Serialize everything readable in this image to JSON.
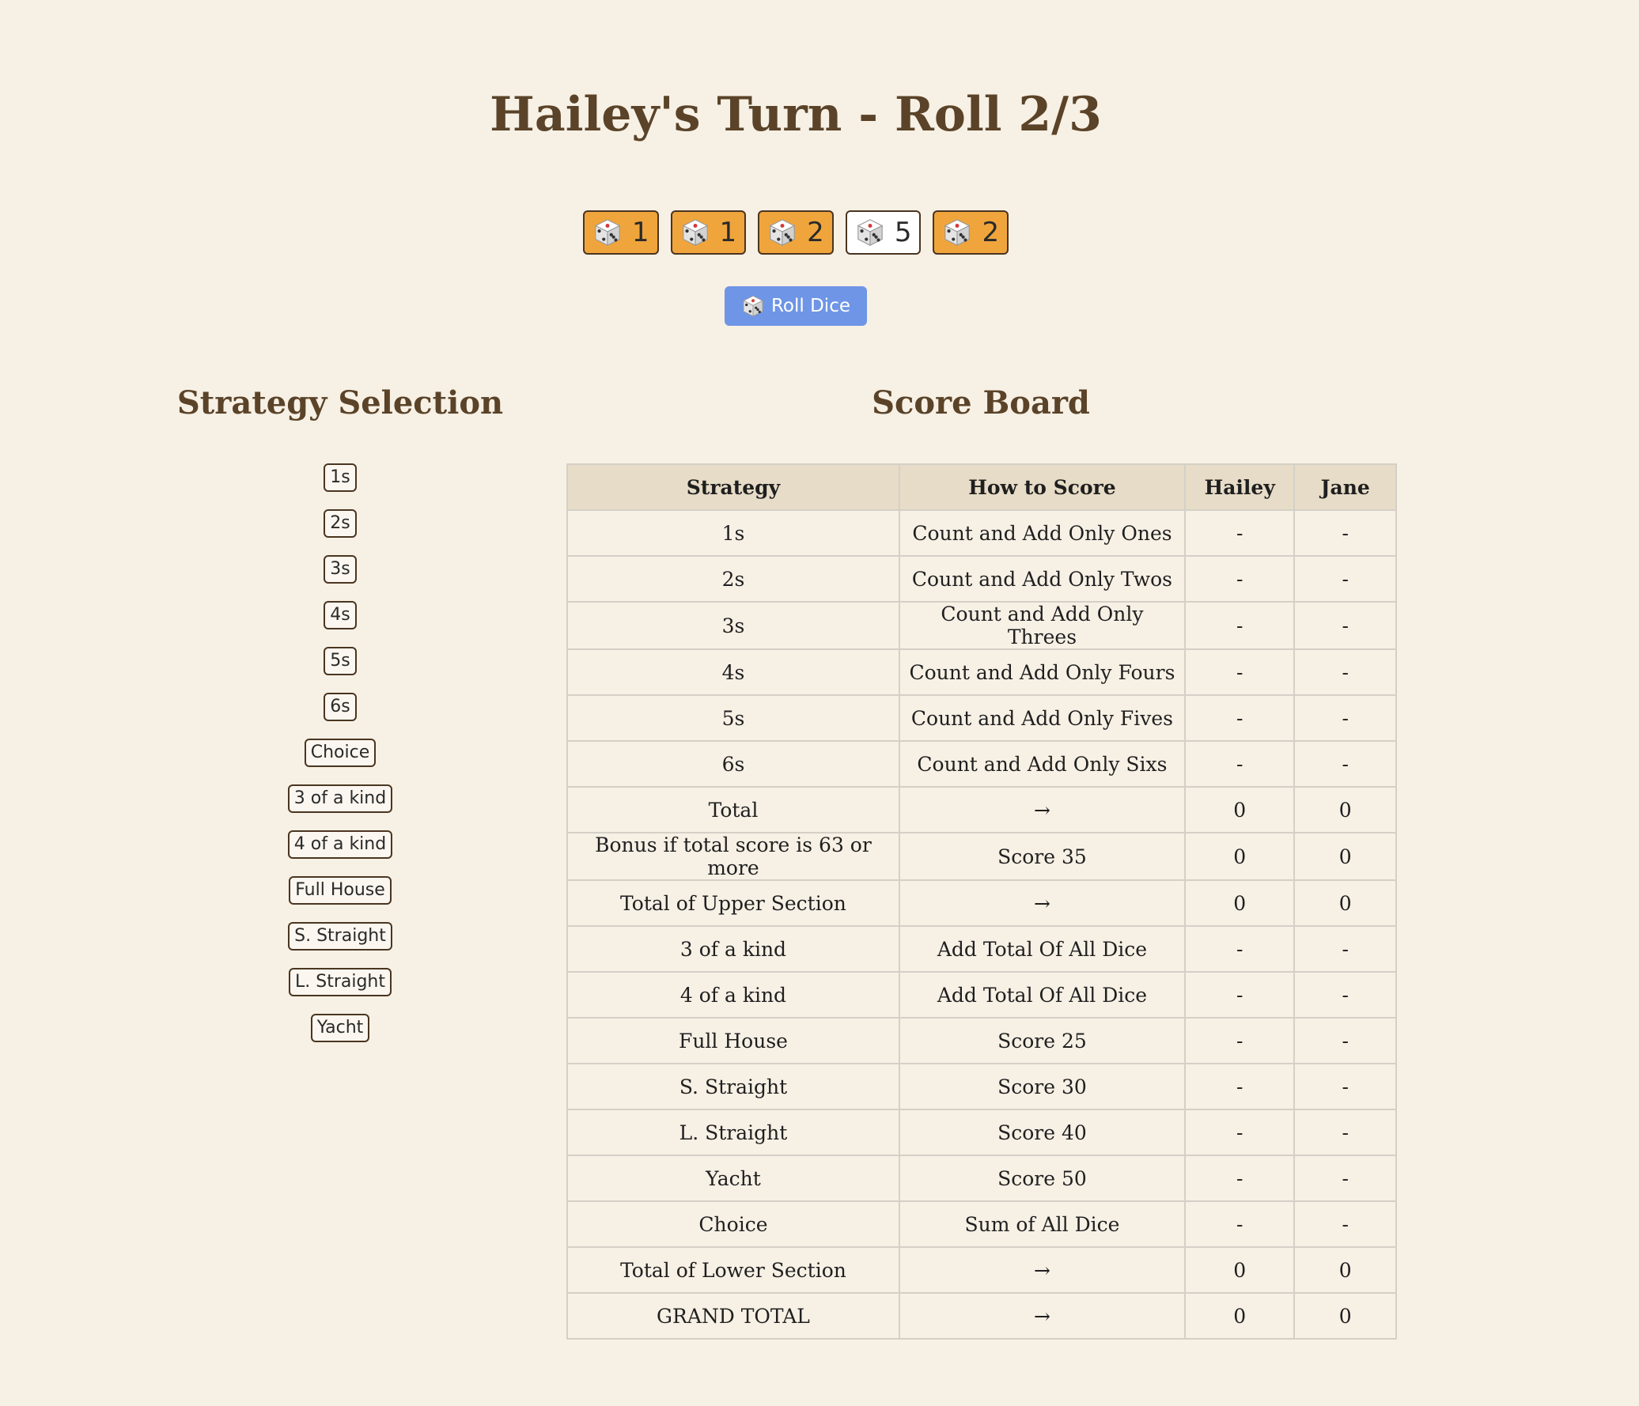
{
  "game": {
    "title": "Hailey's Turn - Roll 2/3"
  },
  "dice": [
    {
      "value": "1",
      "held": false,
      "icon": "die-icon"
    },
    {
      "value": "1",
      "held": false,
      "icon": "die-icon"
    },
    {
      "value": "2",
      "held": false,
      "icon": "die-icon"
    },
    {
      "value": "5",
      "held": true,
      "icon": "die-icon"
    },
    {
      "value": "2",
      "held": false,
      "icon": "die-icon"
    }
  ],
  "roll_button": {
    "label": "Roll Dice",
    "icon": "die-icon"
  },
  "strategy_selection": {
    "heading": "Strategy Selection",
    "options": [
      "1s",
      "2s",
      "3s",
      "4s",
      "5s",
      "6s",
      "Choice",
      "3 of a kind",
      "4 of a kind",
      "Full House",
      "S. Straight",
      "L. Straight",
      "Yacht"
    ]
  },
  "scoreboard": {
    "heading": "Score Board",
    "headers": [
      "Strategy",
      "How to Score",
      "Hailey",
      "Jane"
    ],
    "rows": [
      [
        "1s",
        "Count and Add Only Ones",
        "-",
        "-"
      ],
      [
        "2s",
        "Count and Add Only Twos",
        "-",
        "-"
      ],
      [
        "3s",
        "Count and Add Only Threes",
        "-",
        "-"
      ],
      [
        "4s",
        "Count and Add Only Fours",
        "-",
        "-"
      ],
      [
        "5s",
        "Count and Add Only Fives",
        "-",
        "-"
      ],
      [
        "6s",
        "Count and Add Only Sixs",
        "-",
        "-"
      ],
      [
        "Total",
        "→",
        "0",
        "0"
      ],
      [
        "Bonus if total score is 63 or more",
        "Score 35",
        "0",
        "0"
      ],
      [
        "Total of Upper Section",
        "→",
        "0",
        "0"
      ],
      [
        "3 of a kind",
        "Add Total Of All Dice",
        "-",
        "-"
      ],
      [
        "4 of a kind",
        "Add Total Of All Dice",
        "-",
        "-"
      ],
      [
        "Full House",
        "Score 25",
        "-",
        "-"
      ],
      [
        "S. Straight",
        "Score 30",
        "-",
        "-"
      ],
      [
        "L. Straight",
        "Score 40",
        "-",
        "-"
      ],
      [
        "Yacht",
        "Score 50",
        "-",
        "-"
      ],
      [
        "Choice",
        "Sum of All Dice",
        "-",
        "-"
      ],
      [
        "Total of Lower Section",
        "→",
        "0",
        "0"
      ],
      [
        "GRAND TOTAL",
        "→",
        "0",
        "0"
      ]
    ]
  },
  "colors": {
    "background": "#f7f0e5",
    "heading": "#5a4328",
    "die_active": "#f0a53c",
    "die_held": "#ffffff",
    "roll_button": "#6e95e6",
    "table_header": "#e7dcc7"
  }
}
